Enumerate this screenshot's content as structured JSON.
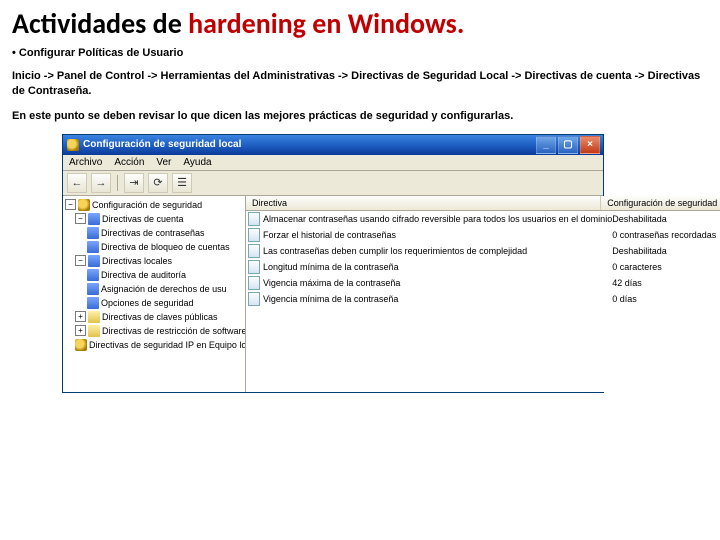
{
  "title": {
    "part1": "Actividades de ",
    "part2": "hardening en Windows",
    "dot": "."
  },
  "bullet": "• Configurar Políticas de Usuario",
  "paragraph1": "Inicio -> Panel de Control -> Herramientas del Administrativas -> Directivas de Seguridad Local ->   Directivas de cuenta -> Directivas de Contraseña.",
  "paragraph2": "En este punto se deben revisar lo que dicen las mejores prácticas de seguridad y configurarlas.",
  "mmc": {
    "titlebar": "Configuración de seguridad local",
    "menu": [
      "Archivo",
      "Acción",
      "Ver",
      "Ayuda"
    ],
    "tree": {
      "root": "Configuración de seguridad",
      "n1": "Directivas de cuenta",
      "n1a": "Directivas de contraseñas",
      "n1b": "Directiva de bloqueo de cuentas",
      "n2": "Directivas locales",
      "n2a": "Directiva de auditoría",
      "n2b": "Asignación de derechos de usu",
      "n2c": "Opciones de seguridad",
      "n3": "Directivas de claves públicas",
      "n4": "Directivas de restricción de software",
      "n5": "Directivas de seguridad IP en Equipo lo"
    },
    "columns": {
      "c1": "Directiva",
      "c2": "Configuración de seguridad"
    },
    "rows": [
      {
        "name": "Almacenar contraseñas usando cifrado reversible para todos los usuarios en el dominio",
        "val": "Deshabilitada"
      },
      {
        "name": "Forzar el historial de contraseñas",
        "val": "0 contraseñas recordadas"
      },
      {
        "name": "Las contraseñas deben cumplir los requerimientos de complejidad",
        "val": "Deshabilitada"
      },
      {
        "name": "Longitud mínima de la contraseña",
        "val": "0 caracteres"
      },
      {
        "name": "Vigencia máxima de la contraseña",
        "val": "42 días"
      },
      {
        "name": "Vigencia mínima de la contraseña",
        "val": "0 días"
      }
    ]
  }
}
